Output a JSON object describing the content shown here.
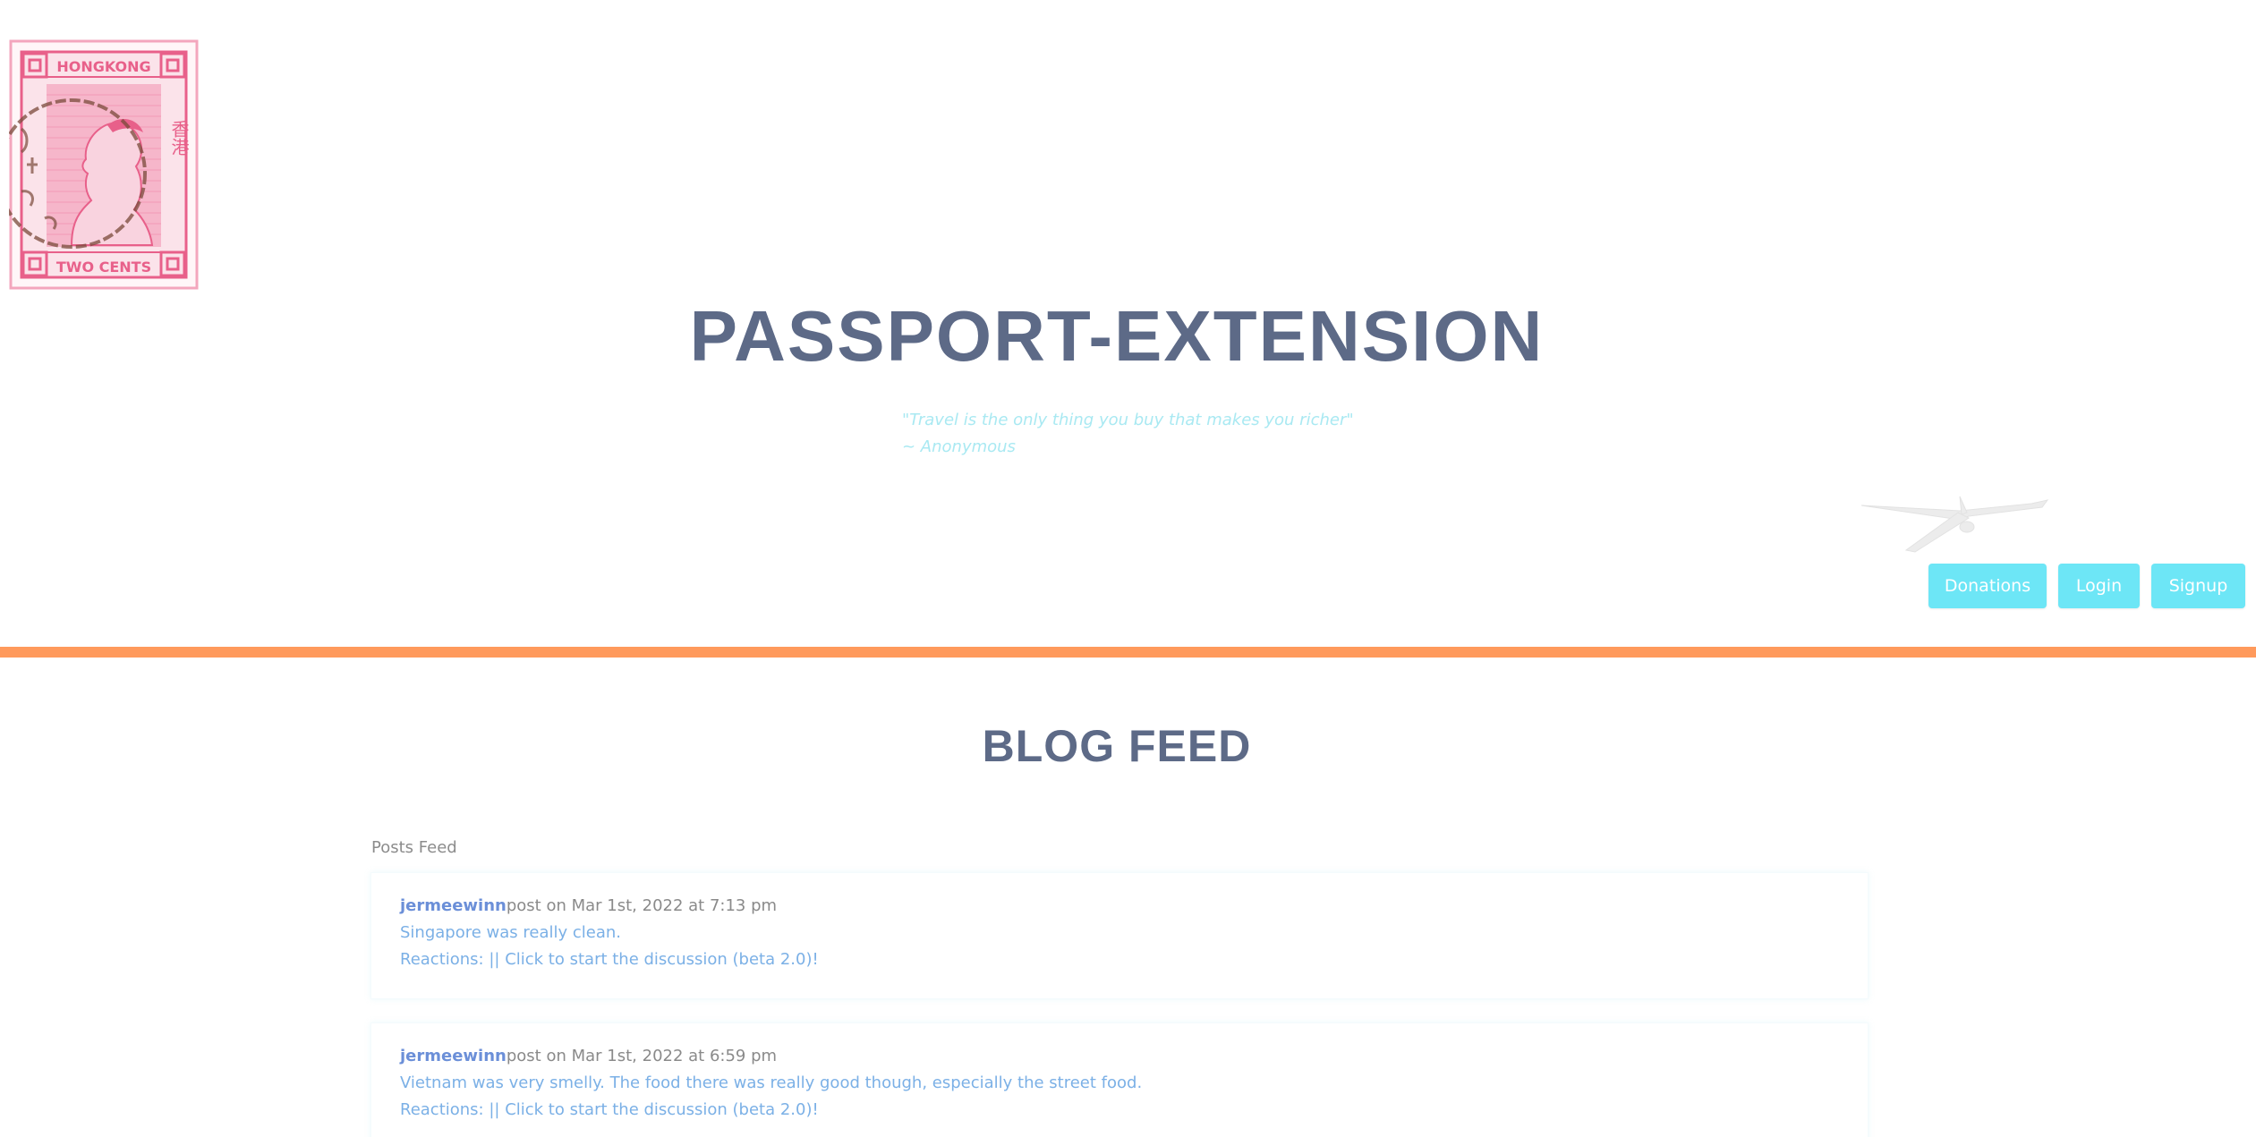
{
  "header": {
    "title": "PASSPORT-EXTENSION",
    "quote_line1": "\"Travel is the only thing you buy that makes you richer\"",
    "quote_line2": "~ Anonymous",
    "stamp": {
      "top_text": "HONGKONG",
      "bottom_text": "TWO CENTS",
      "side_text": "香港",
      "color": "#e8608a"
    }
  },
  "nav": {
    "donations_label": "Donations",
    "login_label": "Login",
    "signup_label": "Signup"
  },
  "blog": {
    "title": "BLOG FEED",
    "posts_label": "Posts Feed",
    "posts": [
      {
        "author": "jermeewinn",
        "meta": "post on Mar 1st, 2022 at 7:13 pm",
        "body": "Singapore was really clean.",
        "reactions": "Reactions: || Click to start the discussion (beta 2.0)!"
      },
      {
        "author": "jermeewinn",
        "meta": "post on Mar 1st, 2022 at 6:59 pm",
        "body": "Vietnam was very smelly. The food there was really good though, especially the street food.",
        "reactions": "Reactions: || Click to start the discussion (beta 2.0)!"
      }
    ]
  },
  "colors": {
    "title": "#5d6a87",
    "accent_bar": "#ff9a5c",
    "button": "#6de6f6",
    "quote": "#a9e9f2",
    "link": "#7bb0e6",
    "author": "#6b8fd8"
  }
}
